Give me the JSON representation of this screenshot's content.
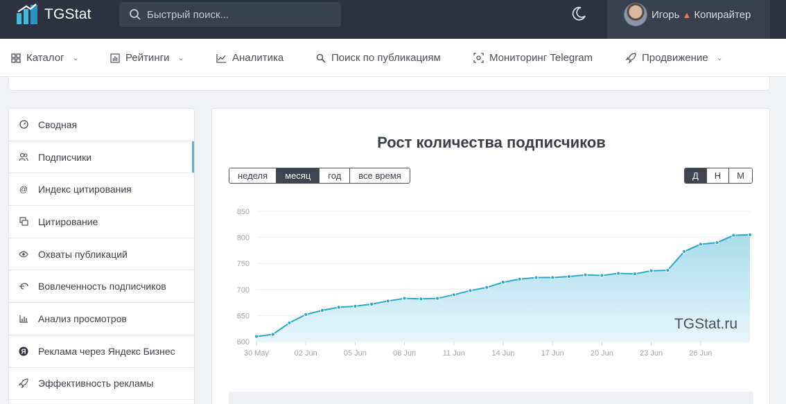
{
  "header": {
    "logo_text": "TGStat",
    "search_placeholder": "Быстрый поиск...",
    "user_name": "Игорь",
    "user_badge": "Копирайтер"
  },
  "nav": [
    {
      "label": "Каталог",
      "icon": "grid-icon",
      "dropdown": true
    },
    {
      "label": "Рейтинги",
      "icon": "bar-chart-icon",
      "dropdown": true
    },
    {
      "label": "Аналитика",
      "icon": "line-chart-icon",
      "dropdown": false
    },
    {
      "label": "Поиск по публикациям",
      "icon": "search-icon",
      "dropdown": false
    },
    {
      "label": "Мониторинг Telegram",
      "icon": "monitor-icon",
      "dropdown": false
    },
    {
      "label": "Продвижение",
      "icon": "rocket-icon",
      "dropdown": true
    }
  ],
  "sidebar": [
    {
      "label": "Сводная",
      "icon": "dashboard-icon"
    },
    {
      "label": "Подписчики",
      "icon": "users-icon",
      "active": true
    },
    {
      "label": "Индекс цитирования",
      "icon": "at-icon"
    },
    {
      "label": "Цитирование",
      "icon": "quote-icon"
    },
    {
      "label": "Охваты публикаций",
      "icon": "eye-icon"
    },
    {
      "label": "Вовлеченность подписчиков",
      "icon": "engagement-icon"
    },
    {
      "label": "Анализ просмотров",
      "icon": "views-chart-icon"
    },
    {
      "label": "Реклама через Яндекс Бизнес",
      "icon": "yandex-icon"
    },
    {
      "label": "Эффективность рекламы",
      "icon": "rocket-icon"
    }
  ],
  "main": {
    "title": "Рост количества подписчиков",
    "period_buttons": [
      "неделя",
      "месяц",
      "год",
      "все время"
    ],
    "period_active": "месяц",
    "granularity_buttons": [
      "Д",
      "Н",
      "М"
    ],
    "granularity_active": "Д",
    "watermark": "TGStat.ru"
  },
  "colors": {
    "line": "#2aa7cc",
    "area_top": "#a8dcec",
    "area_bottom": "#e6f5fa",
    "accent": "#4db8d6"
  },
  "chart_data": {
    "type": "area",
    "title": "Рост количества подписчиков",
    "xlabel": "",
    "ylabel": "",
    "ylim": [
      600,
      850
    ],
    "yticks": [
      600,
      650,
      700,
      750,
      800,
      850
    ],
    "xtick_labels": [
      "30 May",
      "02 Jun",
      "05 Jun",
      "08 Jun",
      "11 Jun",
      "14 Jun",
      "17 Jun",
      "20 Jun",
      "23 Jun",
      "26 Jun"
    ],
    "x": [
      "30 May",
      "31 May",
      "01 Jun",
      "02 Jun",
      "03 Jun",
      "04 Jun",
      "05 Jun",
      "06 Jun",
      "07 Jun",
      "08 Jun",
      "09 Jun",
      "10 Jun",
      "11 Jun",
      "12 Jun",
      "13 Jun",
      "14 Jun",
      "15 Jun",
      "16 Jun",
      "17 Jun",
      "18 Jun",
      "19 Jun",
      "20 Jun",
      "21 Jun",
      "22 Jun",
      "23 Jun",
      "24 Jun",
      "25 Jun",
      "26 Jun",
      "27 Jun",
      "28 Jun",
      "29 Jun"
    ],
    "values": [
      610,
      614,
      636,
      652,
      660,
      666,
      668,
      672,
      678,
      683,
      682,
      683,
      690,
      698,
      704,
      714,
      720,
      723,
      723,
      725,
      728,
      727,
      731,
      730,
      736,
      737,
      773,
      787,
      790,
      804,
      805
    ],
    "grid": true,
    "legend": "none"
  }
}
